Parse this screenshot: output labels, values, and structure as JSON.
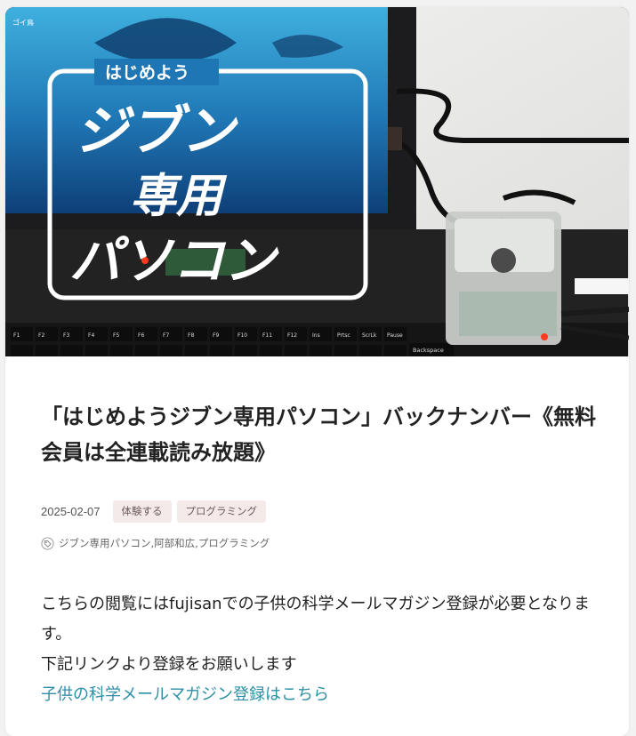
{
  "hero": {
    "banner_small": "はじめよう",
    "title_line1": "ジブン",
    "title_line2": "専用",
    "title_line3": "パソコン",
    "corner_mark": "ゴイ鳥",
    "keyboard_keys": [
      "F1",
      "F2",
      "F3",
      "F4",
      "F5",
      "F6",
      "F7",
      "F8",
      "F9",
      "F10",
      "F11",
      "F12",
      "Ins",
      "Prtsc",
      "ScrLk",
      "Pause"
    ],
    "backspace_key": "Backspace",
    "accent_led": "#ff3b1f"
  },
  "article": {
    "title": "「はじめようジブン専用パソコン」バックナンバー《無料会員は全連載読み放題》",
    "date": "2025-02-07",
    "categories": [
      "体験する",
      "プログラミング"
    ],
    "tags": [
      "ジブン専用パソコン",
      "阿部和広",
      "プログラミング"
    ],
    "tag_separator": ",",
    "body_line1": "こちらの閲覧にはfujisanでの子供の科学メールマガジン登録が必要となります。",
    "body_line2": "下記リンクより登録をお願いします",
    "signup_link": "子供の科学メールマガジン登録はこちら"
  },
  "colors": {
    "link": "#2e8fa6",
    "category_bg": "#f5eaea",
    "page_bg": "#f2f2f2"
  }
}
